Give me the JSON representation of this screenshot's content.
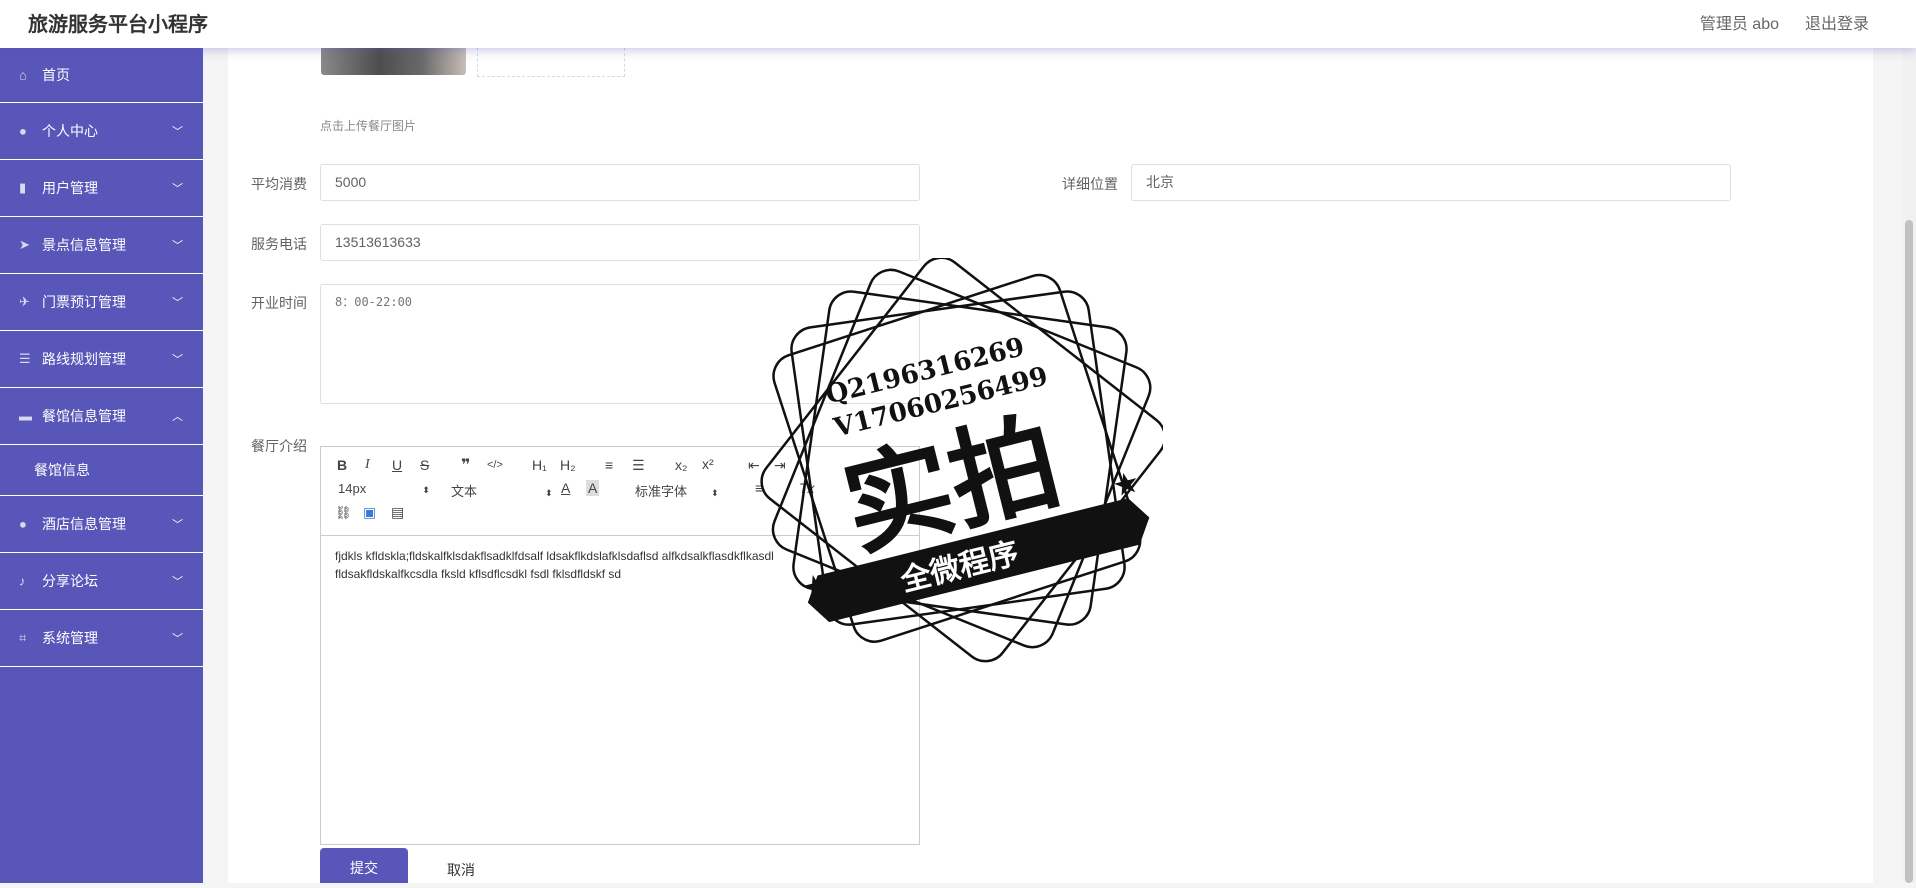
{
  "header": {
    "app_title": "旅游服务平台小程序",
    "user_label": "管理员 abo",
    "logout_label": "退出登录"
  },
  "sidebar": {
    "items": [
      {
        "label": "首页",
        "icon": "home-icon",
        "has_arrow": false
      },
      {
        "label": "个人中心",
        "icon": "user-icon",
        "has_arrow": true
      },
      {
        "label": "用户管理",
        "icon": "bar-chart-icon",
        "has_arrow": true
      },
      {
        "label": "景点信息管理",
        "icon": "navigation-icon",
        "has_arrow": true
      },
      {
        "label": "门票预订管理",
        "icon": "send-icon",
        "has_arrow": true
      },
      {
        "label": "路线规划管理",
        "icon": "list-icon",
        "has_arrow": true
      },
      {
        "label": "餐馆信息管理",
        "icon": "briefcase-icon",
        "has_arrow": true,
        "expanded": true
      },
      {
        "label": "酒店信息管理",
        "icon": "user-icon",
        "has_arrow": true
      },
      {
        "label": "分享论坛",
        "icon": "microphone-icon",
        "has_arrow": true
      },
      {
        "label": "系统管理",
        "icon": "crop-icon",
        "has_arrow": true
      }
    ],
    "sub_item": "餐馆信息"
  },
  "form": {
    "upload_hint": "点击上传餐厅图片",
    "avg_cost_label": "平均消费",
    "avg_cost_value": "5000",
    "location_label": "详细位置",
    "location_value": "北京",
    "phone_label": "服务电话",
    "phone_value": "13513613633",
    "hours_label": "开业时间",
    "hours_value": "8：00-22:00",
    "intro_label": "餐厅介绍",
    "intro_content_line1": "fjdkls kfldskla;fldskalfklsdakflsadklfdsalf ldsakflkdslafklsdaflsd alfkdsalkflasdkflkasdl",
    "intro_content_line2": "fldsakfldskalfkcsdla fksld kflsdflcsdkl fsdl fklsdfldskf sd",
    "submit_label": "提交",
    "cancel_label": "取消"
  },
  "editor_toolbar": {
    "bold": "B",
    "italic": "I",
    "underline": "U",
    "strike": "S",
    "blockquote": "❞",
    "code": "</>",
    "h1": "H₁",
    "h2": "H₂",
    "ordered_list": "≡",
    "bullet_list": "☰",
    "subscript": "x₂",
    "superscript": "x²",
    "outdent": "⇤",
    "indent": "⇥",
    "size": "14px",
    "header_select": "文本",
    "font_color": "A",
    "bg_color": "A",
    "font_family": "标准字体",
    "align": "≡",
    "clean": "Tx",
    "link": "🔗",
    "image": "▣",
    "video": "▤"
  },
  "watermark": {
    "line1": "Q2196316269",
    "line2": "V17060256499",
    "big_text": "实拍",
    "banner_text": "全微程序"
  }
}
